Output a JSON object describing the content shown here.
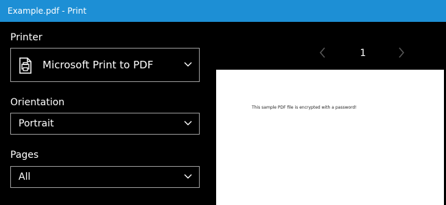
{
  "window": {
    "title": "Example.pdf - Print"
  },
  "colors": {
    "titlebar": "#1d8fd5",
    "pane_background": "#000000",
    "text": "#ffffff",
    "dropdown_border": "#a0a0a0",
    "preview_page": "#ffffff"
  },
  "printer": {
    "label": "Printer",
    "selected": "Microsoft Print to PDF",
    "icon": "printer-icon"
  },
  "orientation": {
    "label": "Orientation",
    "selected": "Portrait"
  },
  "pages": {
    "label": "Pages",
    "selected": "All"
  },
  "preview": {
    "page_number": "1",
    "prev_icon": "chevron-left-icon",
    "next_icon": "chevron-right-icon",
    "page_text": "This sample PDF file is encrypted with a password!"
  }
}
